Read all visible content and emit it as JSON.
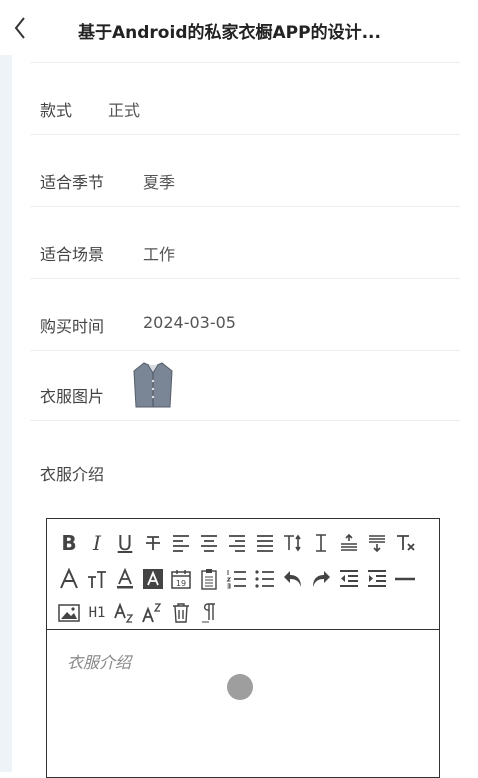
{
  "header": {
    "title": "基于Android的私家衣橱APP的设计..."
  },
  "fields": [
    {
      "label": "款式",
      "value": "正式"
    },
    {
      "label": "适合季节",
      "value": "夏季"
    },
    {
      "label": "适合场景",
      "value": "工作"
    },
    {
      "label": "购买时间",
      "value": "2024-03-05"
    },
    {
      "label": "衣服图片"
    },
    {
      "label": "衣服介绍"
    }
  ],
  "editor": {
    "placeholder": "衣服介绍",
    "toolbar_row1": [
      "bold-icon",
      "italic-icon",
      "underline-icon",
      "strikethrough-icon",
      "align-left-icon",
      "align-center-icon",
      "align-right-icon",
      "align-justify-icon",
      "font-size-icon",
      "line-height-icon",
      "indent-top-icon",
      "indent-bottom-icon",
      "clear-format-icon"
    ],
    "toolbar_row2": [
      "font-family-icon",
      "font-size-small-icon",
      "font-color-icon",
      "background-color-icon",
      "date-icon",
      "clipboard-icon",
      "ordered-list-icon",
      "unordered-list-icon",
      "undo-icon",
      "redo-icon",
      "outdent-icon",
      "indent-icon",
      "horizontal-rule-icon"
    ],
    "toolbar_row3": [
      "image-icon",
      "heading-icon",
      "subscript-icon",
      "superscript-icon",
      "delete-icon",
      "paragraph-icon"
    ],
    "toolbar_text": {
      "bold": "B",
      "italic": "I",
      "underline": "U",
      "heading": "H1"
    }
  }
}
